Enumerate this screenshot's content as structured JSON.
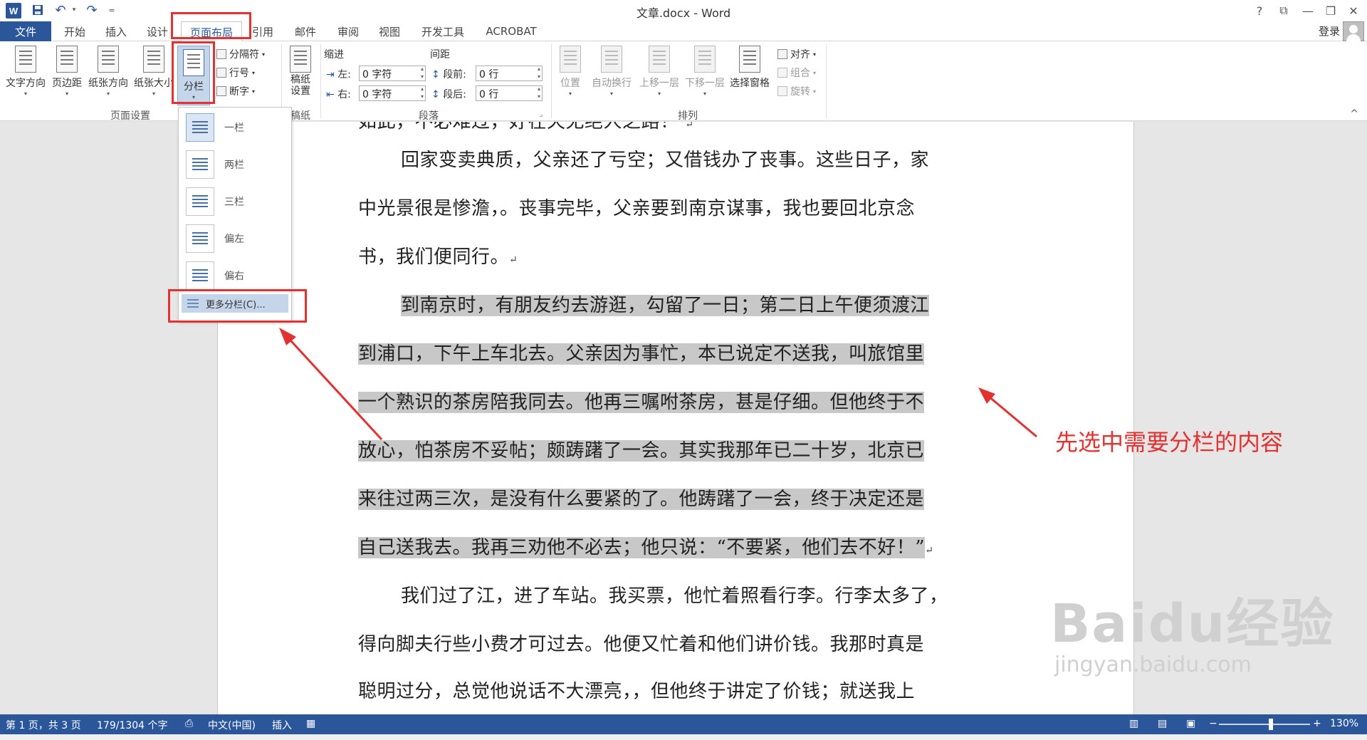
{
  "window": {
    "title": "文章.docx - Word",
    "help": "?",
    "minimize": "—",
    "restore": "❐",
    "close": "✕",
    "ribbon_display": "⧉"
  },
  "quick_access": {
    "word_logo": "W",
    "save": "💾",
    "undo": "↶",
    "redo": "↷",
    "customize": "="
  },
  "tabs": [
    {
      "label": "文件"
    },
    {
      "label": "开始"
    },
    {
      "label": "插入"
    },
    {
      "label": "设计"
    },
    {
      "label": "页面布局"
    },
    {
      "label": "引用"
    },
    {
      "label": "邮件"
    },
    {
      "label": "审阅"
    },
    {
      "label": "视图"
    },
    {
      "label": "开发工具"
    },
    {
      "label": "ACROBAT"
    }
  ],
  "account": {
    "signin": "登录"
  },
  "ribbon": {
    "page_setup": {
      "label": "页面设置",
      "text_direction": "文字方向",
      "margins": "页边距",
      "orientation": "纸张方向",
      "size": "纸张大小",
      "columns": "分栏",
      "breaks": "分隔符",
      "line_numbers": "行号",
      "hyphenation": "断字"
    },
    "draft": {
      "label": "稿纸",
      "draft_settings_1": "稿纸",
      "draft_settings_2": "设置"
    },
    "paragraph": {
      "label": "段落",
      "indent_header": "缩进",
      "spacing_header": "间距",
      "indent_left_label": "左:",
      "indent_left_value": "0 字符",
      "indent_right_label": "右:",
      "indent_right_value": "0 字符",
      "spacing_before_label": "段前:",
      "spacing_before_value": "0 行",
      "spacing_after_label": "段后:",
      "spacing_after_value": "0 行"
    },
    "arrange": {
      "label": "排列",
      "position": "位置",
      "wrap_text": "自动换行",
      "bring_forward": "上移一层",
      "send_backward": "下移一层",
      "selection_pane": "选择窗格",
      "align": "对齐",
      "group": "组合",
      "rotate": "旋转"
    },
    "collapse": "^"
  },
  "columns_menu": {
    "items": [
      {
        "label": "一栏"
      },
      {
        "label": "两栏"
      },
      {
        "label": "三栏"
      },
      {
        "label": "偏左"
      },
      {
        "label": "偏右"
      }
    ],
    "more": "更多分栏(C)..."
  },
  "document": {
    "lines": [
      "如此，不必难过，好在天无绝人之路！",
      "回家变卖典质，父亲还了亏空；又借钱办了丧事。这些日子，家",
      "中光景很是惨澹，。丧事完毕，父亲要到南京谋事，我也要回北京念",
      "书，我们便同行。",
      "到南京时，有朋友约去游逛，勾留了一日；第二日上午便须渡江",
      "到浦口，下午上车北去。父亲因为事忙，本已说定不送我，叫旅馆里",
      "一个熟识的茶房陪我同去。他再三嘱咐茶房，甚是仔细。但他终于不",
      "放心，怕茶房不妥帖；颇踌躇了一会。其实我那年已二十岁，北京已",
      "来往过两三次，是没有什么要紧的了。他踌躇了一会，终于决定还是",
      "自己送我去。我再三劝他不必去；他只说：“不要紧，他们去不好！”",
      "我们过了江，进了车站。我买票，他忙着照看行李。行李太多了，",
      "得向脚夫行些小费才可过去。他便又忙着和他们讲价钱。我那时真是",
      "聪明过分，总觉他说话不大漂亮，，但他终于讲定了价钱；就送我上"
    ],
    "para_mark": "↵"
  },
  "annotation": {
    "text": "先选中需要分栏的内容"
  },
  "watermark": {
    "brand": "Baidu经验",
    "url": "jingyan.baidu.com"
  },
  "statusbar": {
    "page": "第 1 页，共 3 页",
    "words": "179/1304 个字",
    "language": "中文(中国)",
    "mode": "插入",
    "zoom_minus": "−",
    "zoom_plus": "+",
    "zoom": "130%"
  },
  "colors": {
    "accent": "#2b579a",
    "annotation": "#e53030",
    "selection": "#c8c8c8"
  }
}
